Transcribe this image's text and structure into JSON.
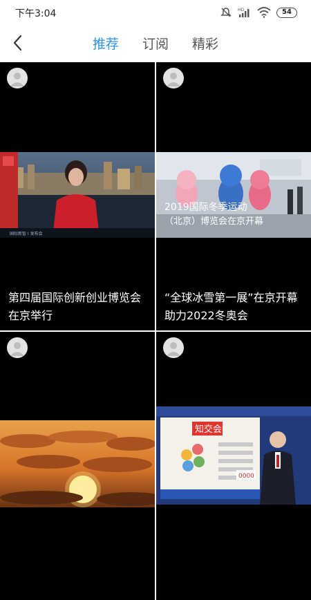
{
  "status_bar": {
    "time": "下午3:04",
    "battery": "54",
    "icons": [
      "mute-icon",
      "hd-signal-icon",
      "wifi-icon",
      "battery-icon"
    ]
  },
  "nav": {
    "back_icon": "chevron-left-icon",
    "tabs": [
      {
        "label": "推荐",
        "active": true
      },
      {
        "label": "订阅",
        "active": false
      },
      {
        "label": "精彩",
        "active": false
      }
    ]
  },
  "colors": {
    "accent": "#2f8ff0",
    "card_bg": "#000000"
  },
  "feed": {
    "items": [
      {
        "caption": "第四届国际创新创业博览会在京举行",
        "thumb_text": "国际新智 Ⅰ 发布会"
      },
      {
        "caption": "“全球冰雪第一展”在京开幕助力2022冬奥会",
        "thumb_text_line1": "2019国际冬季运动",
        "thumb_text_line2": "（北京）博览会在京开幕"
      },
      {
        "caption": ""
      },
      {
        "caption": "",
        "thumb_text": "知交会",
        "thumb_badge": "0000"
      }
    ]
  }
}
